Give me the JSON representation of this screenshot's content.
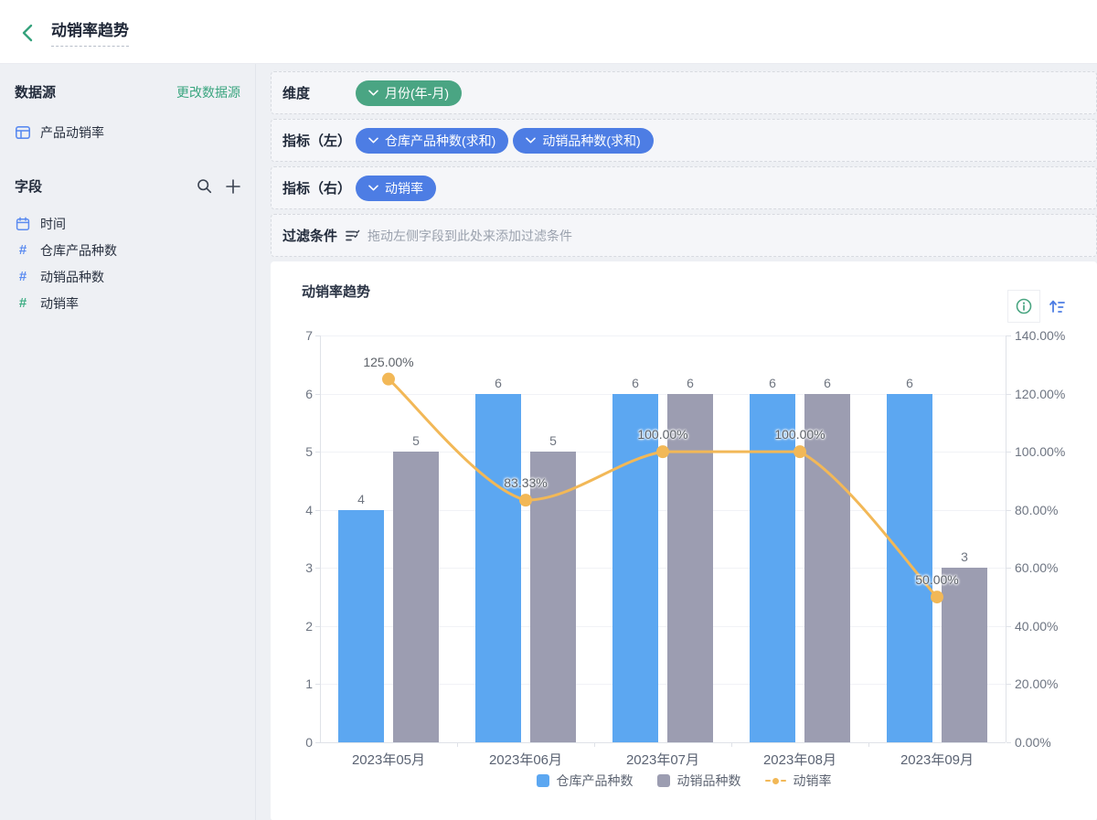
{
  "header": {
    "title": "动销率趋势"
  },
  "sidebar": {
    "datasource_label": "数据源",
    "change_datasource": "更改数据源",
    "datasource_name": "产品动销率",
    "fields_label": "字段",
    "fields": [
      {
        "label": "时间",
        "icon": "calendar-icon",
        "color": "#5b8bf0"
      },
      {
        "label": "仓库产品种数",
        "icon": "number-icon",
        "color": "#5b8bf0"
      },
      {
        "label": "动销品种数",
        "icon": "number-icon",
        "color": "#5b8bf0"
      },
      {
        "label": "动销率",
        "icon": "number-icon",
        "color": "#3fae85"
      }
    ]
  },
  "config_rows": [
    {
      "id": "dimension",
      "label": "维度",
      "pills": [
        {
          "text": "月份(年-月)",
          "color": "green"
        }
      ]
    },
    {
      "id": "metrics-left",
      "label": "指标（左）",
      "pills": [
        {
          "text": "仓库产品种数(求和)",
          "color": "blue"
        },
        {
          "text": "动销品种数(求和)",
          "color": "blue"
        }
      ]
    },
    {
      "id": "metrics-right",
      "label": "指标（右）",
      "pills": [
        {
          "text": "动销率",
          "color": "blue"
        }
      ]
    },
    {
      "id": "filter",
      "label": "过滤条件",
      "icon": "filter-icon",
      "hint": "拖动左侧字段到此处来添加过滤条件",
      "pills": []
    }
  ],
  "chart_data": {
    "type": "combo",
    "title": "动销率趋势",
    "categories": [
      "2023年05月",
      "2023年06月",
      "2023年07月",
      "2023年08月",
      "2023年09月"
    ],
    "series": [
      {
        "name": "仓库产品种数",
        "type": "bar",
        "axis": "left",
        "color": "#5ca7f1",
        "values": [
          4,
          6,
          6,
          6,
          6
        ]
      },
      {
        "name": "动销品种数",
        "type": "bar",
        "axis": "left",
        "color": "#9c9db1",
        "values": [
          5,
          5,
          6,
          6,
          3
        ]
      },
      {
        "name": "动销率",
        "type": "line",
        "axis": "right",
        "color": "#f2b857",
        "values": [
          125,
          83.33,
          100,
          100,
          50
        ],
        "labels": [
          "125.00%",
          "83.33%",
          "100.00%",
          "100.00%",
          "50.00%"
        ]
      }
    ],
    "left_axis": {
      "min": 0,
      "max": 7,
      "step": 1
    },
    "right_axis": {
      "min": 0,
      "max": 140,
      "step": 20,
      "format": "percent",
      "decimals": 2
    },
    "legend": [
      "仓库产品种数",
      "动销品种数",
      "动销率"
    ],
    "legend_position": "bottom",
    "grid": true
  },
  "colors": {
    "accent_green": "#35a27c",
    "link_green": "#3aa57f",
    "pill_green": "#4aa583",
    "pill_blue": "#4d7de4",
    "field_icon_blue": "#5b8bf0",
    "field_icon_green": "#3fae85",
    "bar_blue": "#5ca7f1",
    "bar_gray": "#9c9db1",
    "line_orange": "#f2b857"
  }
}
